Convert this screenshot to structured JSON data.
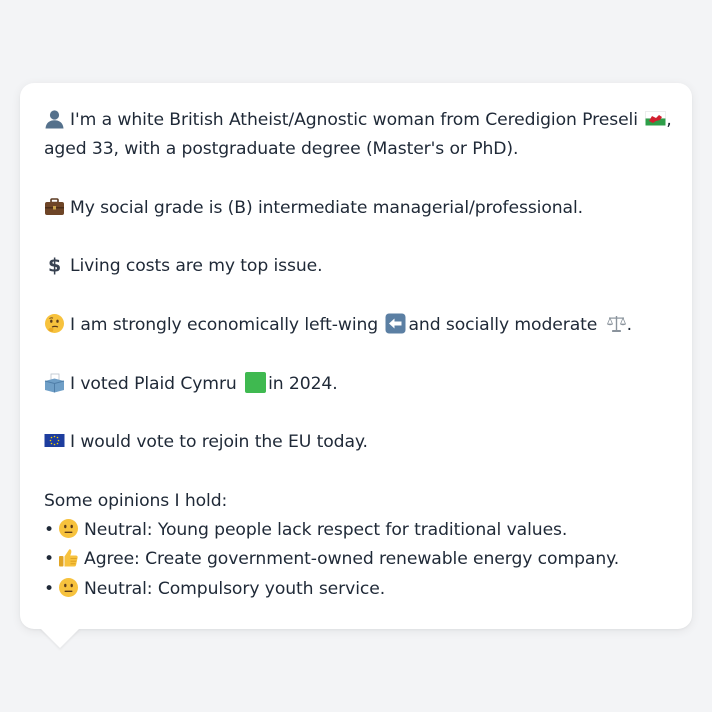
{
  "profile": {
    "identity_line1": "I'm a white British Atheist/Agnostic woman from Ceredigion Preseli",
    "identity_line1_end": ",",
    "identity_line2": "aged 33, with a postgraduate degree (Master's or PhD).",
    "social_grade": "My social grade is (B) intermediate managerial/professional.",
    "top_issue": "Living costs are my top issue.",
    "ideology_a": "I am strongly economically left-wing",
    "ideology_b": "and socially moderate",
    "ideology_end": ".",
    "vote_a": "I voted Plaid Cymru",
    "vote_b": "in 2024.",
    "eu": "I would vote to rejoin the EU today."
  },
  "opinions": {
    "heading": "Some opinions I hold:",
    "items": [
      {
        "bullet": "•",
        "icon": "neutral-face-icon",
        "text": "Neutral: Young people lack respect for traditional values."
      },
      {
        "bullet": "•",
        "icon": "thumbs-up-icon",
        "text": "Agree: Create government-owned renewable energy company."
      },
      {
        "bullet": "•",
        "icon": "neutral-face-icon",
        "text": "Neutral: Compulsory youth service."
      }
    ]
  },
  "icons": {
    "person": "person-icon",
    "flag": "wales-flag-icon",
    "briefcase": "briefcase-icon",
    "dollar": "dollar-sign-icon",
    "thinking": "thinking-face-icon",
    "left_arrow": "left-arrow-icon",
    "scales": "balance-scale-icon",
    "ballot": "ballot-box-icon",
    "party": "green-square-icon",
    "eu": "eu-flag-icon"
  },
  "colors": {
    "background": "#f3f4f6",
    "card": "#ffffff",
    "text": "#1f2937",
    "party_green": "#3fb950",
    "eu_blue": "#1d3d9e"
  }
}
